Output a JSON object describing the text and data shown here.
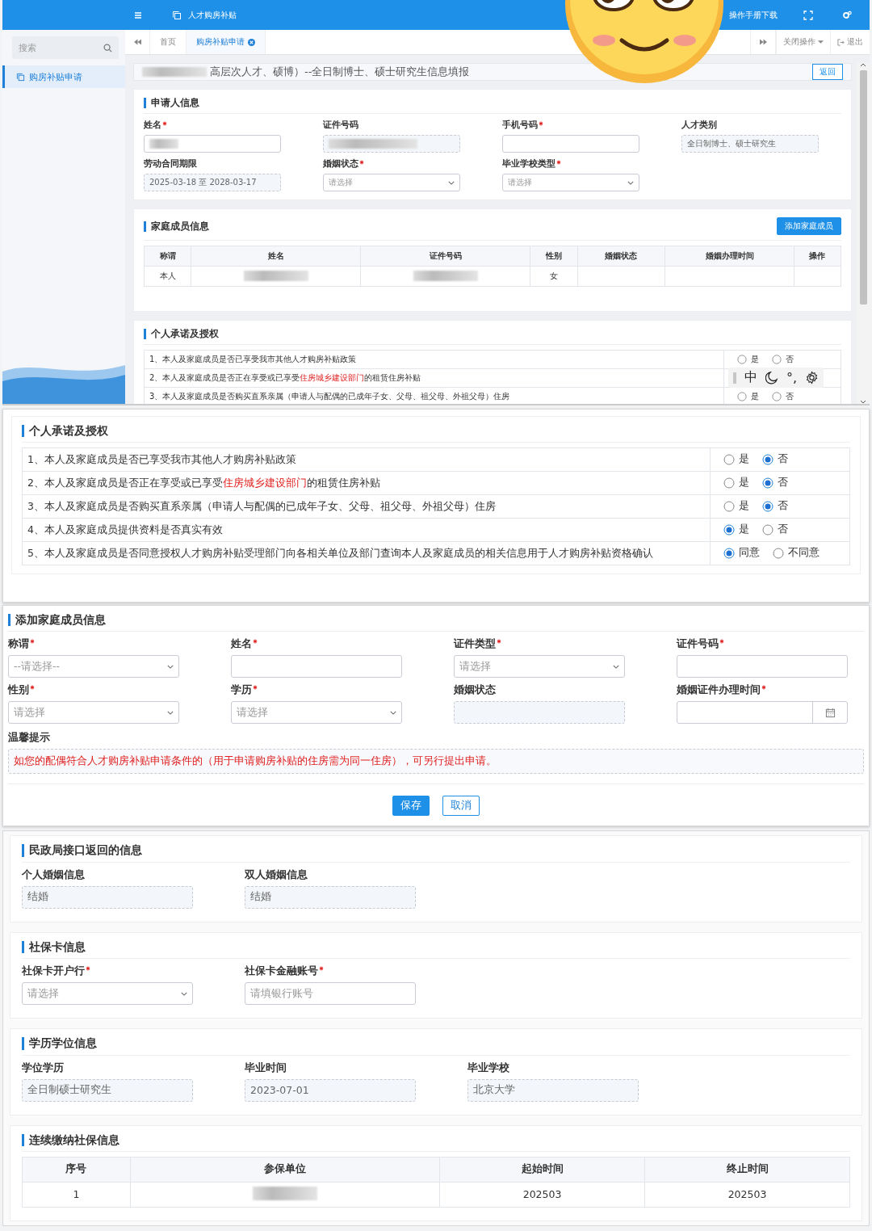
{
  "app": {
    "title": "人才购房补贴",
    "manual_link": "操作手册下载"
  },
  "sidebar": {
    "search_placeholder": "搜索",
    "items": [
      {
        "label": "购房补贴申请",
        "selected": true
      }
    ]
  },
  "tabs": [
    {
      "label": "首页",
      "selected": false,
      "closable": false
    },
    {
      "label": "购房补贴申请",
      "selected": true,
      "closable": true
    }
  ],
  "tab_actions": {
    "close_menu": "关闭操作",
    "logout": "退出"
  },
  "page": {
    "title": "高层次人才、硕博）--全日制博士、硕士研究生信息填报",
    "title_redacted": true,
    "back_button": "返回"
  },
  "applicant": {
    "title": "申请人信息",
    "fields": [
      {
        "label": "姓名",
        "required": true,
        "kind": "input",
        "redacted": true
      },
      {
        "label": "证件号码",
        "kind": "readonly",
        "redacted": true
      },
      {
        "label": "手机号码",
        "required": true,
        "kind": "input"
      },
      {
        "label": "人才类别",
        "kind": "readonly",
        "value": "全日制博士、硕士研究生"
      },
      {
        "label": "劳动合同期限",
        "kind": "readonly",
        "value": "2025-03-18 至 2028-03-17"
      },
      {
        "label": "婚姻状态",
        "required": true,
        "kind": "select",
        "placeholder": "请选择"
      },
      {
        "label": "毕业学校类型",
        "required": true,
        "kind": "select",
        "placeholder": "请选择"
      }
    ]
  },
  "family": {
    "title": "家庭成员信息",
    "add_button": "添加家庭成员",
    "columns": [
      "称谓",
      "姓名",
      "证件号码",
      "性别",
      "婚姻状态",
      "婚姻办理时间",
      "操作"
    ],
    "rows": [
      [
        {
          "kind": "text",
          "text": "本人"
        },
        {
          "kind": "blurred"
        },
        {
          "kind": "blurred"
        },
        {
          "kind": "text",
          "text": "女"
        },
        {
          "kind": "empty"
        },
        {
          "kind": "empty"
        },
        {
          "kind": "empty"
        }
      ]
    ]
  },
  "commitments_preview": {
    "title": "个人承诺及授权",
    "items": [
      {
        "segments": [
          {
            "text": "1、本人及家庭成员是否已享受我市其他人才购房补贴政策",
            "highlight": false
          }
        ],
        "options": [
          {
            "label": "是",
            "selected": false
          },
          {
            "label": "否",
            "selected": false
          }
        ]
      },
      {
        "segments": [
          {
            "text": "2、本人及家庭成员是否正在享受或已享受",
            "highlight": false
          },
          {
            "text": "住房城乡建设部门",
            "highlight": true
          },
          {
            "text": "的租赁住房补贴",
            "highlight": false
          }
        ]
      },
      {
        "segments": [
          {
            "text": "3、本人及家庭成员是否购买直系亲属（申请人与配偶的已成年子女、父母、祖父母、外祖父母）住房",
            "highlight": false
          }
        ],
        "options": [
          {
            "label": "是",
            "selected": false
          },
          {
            "label": "否",
            "selected": false
          }
        ]
      }
    ]
  },
  "ime_toolbar": {
    "mode": "中",
    "punctuation": "°,"
  },
  "commitments": {
    "title": "个人承诺及授权",
    "items": [
      {
        "segments": [
          {
            "text": "1、本人及家庭成员是否已享受我市其他人才购房补贴政策",
            "highlight": false
          }
        ],
        "options": [
          {
            "label": "是",
            "selected": false
          },
          {
            "label": "否",
            "selected": true
          }
        ]
      },
      {
        "segments": [
          {
            "text": "2、本人及家庭成员是否正在享受或已享受",
            "highlight": false
          },
          {
            "text": "住房城乡建设部门",
            "highlight": true
          },
          {
            "text": "的租赁住房补贴",
            "highlight": false
          }
        ],
        "options": [
          {
            "label": "是",
            "selected": false
          },
          {
            "label": "否",
            "selected": true
          }
        ]
      },
      {
        "segments": [
          {
            "text": "3、本人及家庭成员是否购买直系亲属（申请人与配偶的已成年子女、父母、祖父母、外祖父母）住房",
            "highlight": false
          }
        ],
        "options": [
          {
            "label": "是",
            "selected": false
          },
          {
            "label": "否",
            "selected": true
          }
        ]
      },
      {
        "segments": [
          {
            "text": "4、本人及家庭成员提供资料是否真实有效",
            "highlight": false
          }
        ],
        "options": [
          {
            "label": "是",
            "selected": true
          },
          {
            "label": "否",
            "selected": false
          }
        ]
      },
      {
        "segments": [
          {
            "text": "5、本人及家庭成员是否同意授权人才购房补贴受理部门向各相关单位及部门查询本人及家庭成员的相关信息用于人才购房补贴资格确认",
            "highlight": false
          }
        ],
        "options": [
          {
            "label": "同意",
            "selected": true
          },
          {
            "label": "不同意",
            "selected": false
          }
        ]
      }
    ]
  },
  "add_member": {
    "title": "添加家庭成员信息",
    "fields": [
      {
        "label": "称谓",
        "required": true,
        "kind": "select",
        "placeholder": "--请选择--"
      },
      {
        "label": "姓名",
        "required": true,
        "kind": "input"
      },
      {
        "label": "证件类型",
        "required": true,
        "kind": "select",
        "placeholder": "请选择"
      },
      {
        "label": "证件号码",
        "required": true,
        "kind": "input"
      },
      {
        "label": "性别",
        "required": true,
        "kind": "select",
        "placeholder": "请选择"
      },
      {
        "label": "学历",
        "required": true,
        "kind": "select",
        "placeholder": "请选择"
      },
      {
        "label": "婚姻状态",
        "kind": "readonly"
      },
      {
        "label": "婚姻证件办理时间",
        "required": true,
        "kind": "date"
      }
    ],
    "tip_label": "温馨提示",
    "tip": "如您的配偶符合人才购房补贴申请条件的（用于申请购房补贴的住房需为同一住房），可另行提出申请。",
    "save_button": "保存",
    "cancel_button": "取消"
  },
  "civil_affairs": {
    "title": "民政局接口返回的信息",
    "fields": [
      {
        "label": "个人婚姻信息",
        "kind": "readonly",
        "value": "结婚"
      },
      {
        "label": "双人婚姻信息",
        "kind": "readonly",
        "value": "结婚"
      }
    ]
  },
  "social_card": {
    "title": "社保卡信息",
    "fields": [
      {
        "label": "社保卡开户行",
        "required": true,
        "kind": "select",
        "placeholder": "请选择"
      },
      {
        "label": "社保卡金融账号",
        "required": true,
        "kind": "input",
        "placeholder": "请填银行账号"
      }
    ]
  },
  "education": {
    "title": "学历学位信息",
    "fields": [
      {
        "label": "学位学历",
        "kind": "readonly",
        "value": "全日制硕士研究生"
      },
      {
        "label": "毕业时间",
        "kind": "readonly",
        "value": "2023-07-01"
      },
      {
        "label": "毕业学校",
        "kind": "readonly",
        "value": "北京大学"
      }
    ]
  },
  "social_insurance": {
    "title": "连续缴纳社保信息",
    "columns": [
      "序号",
      "参保单位",
      "起始时间",
      "终止时间"
    ],
    "rows": [
      [
        {
          "kind": "text",
          "text": "1"
        },
        {
          "kind": "blurred"
        },
        {
          "kind": "text",
          "text": "202503"
        },
        {
          "kind": "text",
          "text": "202503"
        }
      ]
    ]
  }
}
